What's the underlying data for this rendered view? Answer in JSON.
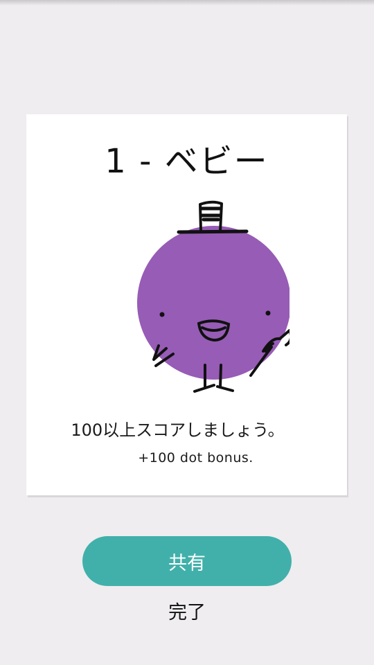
{
  "card": {
    "title": "1 - ベビー",
    "goal": "100以上スコアしましょう。",
    "bonus": "+100 dot bonus.",
    "character_icon": "purple-round-creature-with-top-hat",
    "character_color": "#975cb6"
  },
  "actions": {
    "share_label": "共有",
    "done_label": "完了"
  },
  "colors": {
    "background": "#efedf0",
    "card": "#ffffff",
    "accent": "#41b0aa"
  }
}
